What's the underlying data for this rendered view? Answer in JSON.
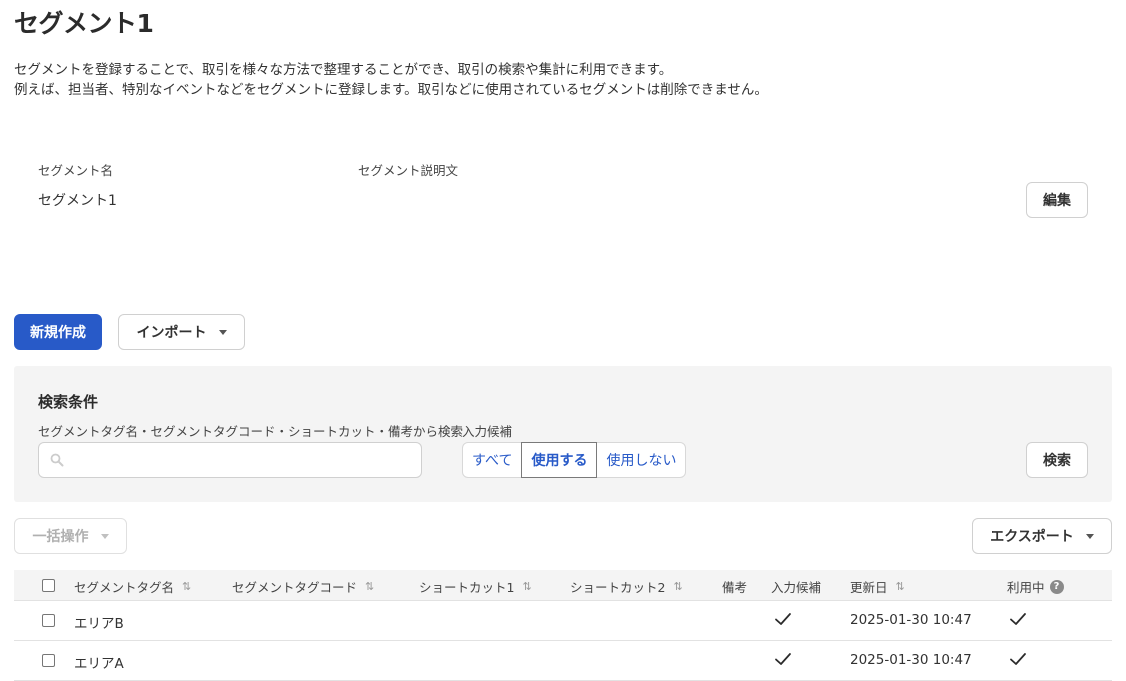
{
  "page": {
    "title": "セグメント1",
    "description_line1": "セグメントを登録することで、取引を様々な方法で整理することができ、取引の検索や集計に利用できます。",
    "description_line2": "例えば、担当者、特別なイベントなどをセグメントに登録します。取引などに使用されているセグメントは削除できません。"
  },
  "segment_info": {
    "name_label": "セグメント名",
    "name_value": "セグメント1",
    "description_label": "セグメント説明文",
    "description_value": "",
    "edit_label": "編集"
  },
  "actions": {
    "new_label": "新規作成",
    "import_label": "インポート"
  },
  "search": {
    "title": "検索条件",
    "field_label": "セグメントタグ名・セグメントタグコード・ショートカット・備考から検索",
    "input_value": "",
    "input_placeholder": "",
    "candidate_label": "入力候補",
    "options": [
      "すべて",
      "使用する",
      "使用しない"
    ],
    "selected_option": "使用する",
    "search_button_label": "検索"
  },
  "toolbar": {
    "bulk_label": "一括操作",
    "export_label": "エクスポート"
  },
  "table": {
    "headers": {
      "name": "セグメントタグ名",
      "code": "セグメントタグコード",
      "shortcut1": "ショートカット1",
      "shortcut2": "ショートカット2",
      "note": "備考",
      "candidate": "入力候補",
      "updated": "更新日",
      "in_use": "利用中"
    },
    "sort_icon": "⇅",
    "rows": [
      {
        "name": "エリアB",
        "code": "",
        "shortcut1": "",
        "shortcut2": "",
        "note": "",
        "candidate": true,
        "updated": "2025-01-30 10:47",
        "in_use": true
      },
      {
        "name": "エリアA",
        "code": "",
        "shortcut1": "",
        "shortcut2": "",
        "note": "",
        "candidate": true,
        "updated": "2025-01-30 10:47",
        "in_use": true
      }
    ]
  },
  "colors": {
    "primary": "#285ac8",
    "panel_bg": "#f4f4f4",
    "text": "#323232"
  },
  "icons": {
    "search": "search-icon",
    "check": "check-icon",
    "help": "help-icon",
    "dropdown": "chevron-down-icon"
  }
}
